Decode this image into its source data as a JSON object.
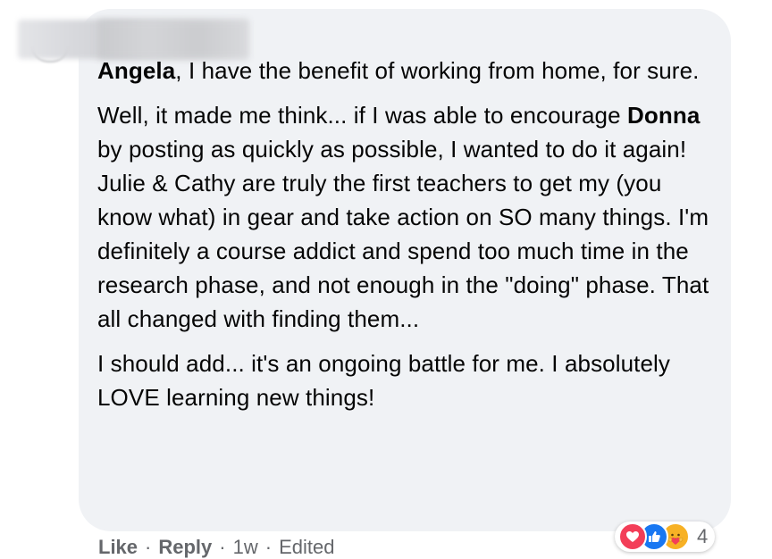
{
  "comment": {
    "mention": "Angela",
    "line1_rest": ", I have the benefit of working from home, for sure.",
    "p2_before": "Well, it made me think... if I was able to encourage ",
    "p2_mention": "Donna",
    "p2_after": " by posting as quickly as possible, I wanted to do it again! Julie & Cathy are truly the first teachers to get my (you know what) in gear and take action on SO many things. I'm definitely a course addict and spend too much time in the research phase, and not enough in the \"doing\" phase. That all changed with finding them...",
    "p3": "I should add... it's an ongoing battle for me. I absolutely LOVE learning new things!"
  },
  "actions": {
    "like": "Like",
    "reply": "Reply",
    "separator": "·",
    "time": "1w",
    "edited": "Edited"
  },
  "reactions": {
    "icons": [
      "love-icon",
      "like-icon",
      "care-icon"
    ],
    "count": "4"
  },
  "colors": {
    "bubble": "#f0f2f5",
    "text": "#050505",
    "meta": "#65676b",
    "love": "#f33e58",
    "like": "#1877f2",
    "care": "#f7b125"
  }
}
